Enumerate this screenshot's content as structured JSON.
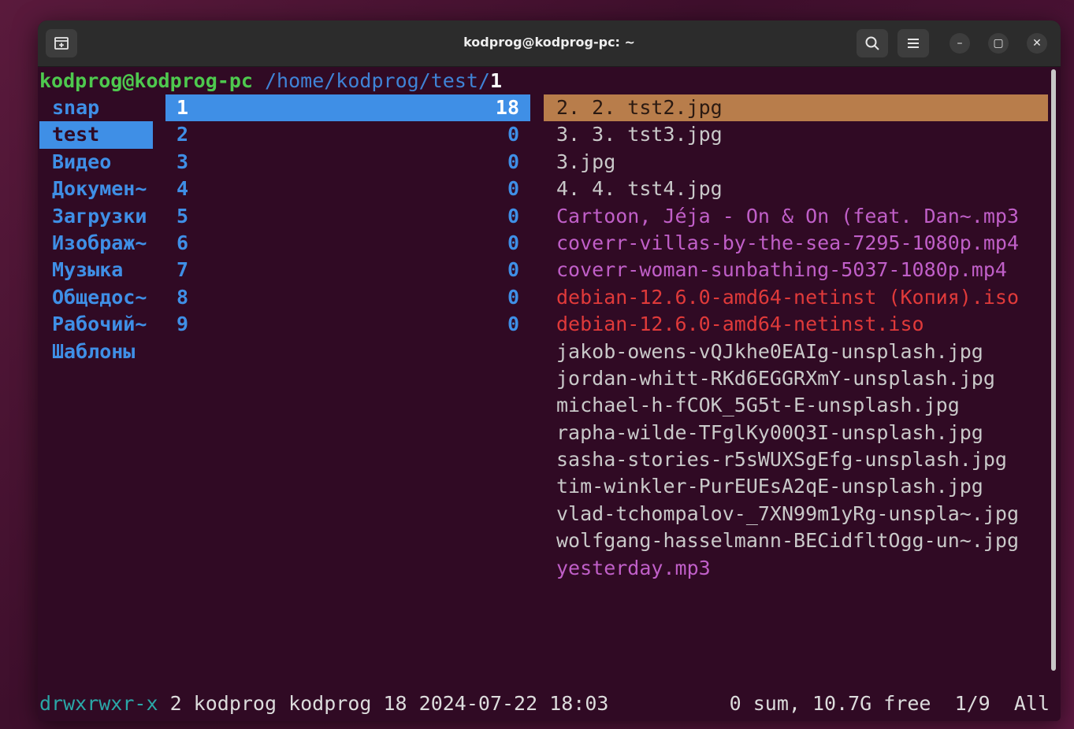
{
  "window": {
    "title": "kodprog@kodprog-pc: ~",
    "buttons": {
      "new_tab_icon": "new-tab-icon",
      "search_icon": "search-icon",
      "menu_icon": "hamburger-menu-icon",
      "minimize": "–",
      "maximize": "▢",
      "close": "✕"
    }
  },
  "prompt": {
    "user": "kodprog@kodprog-pc",
    "path": "/home/kodprog/test/",
    "current": "1"
  },
  "parent_dirs": [
    {
      "label": "snap"
    },
    {
      "label": "test"
    },
    {
      "label": "Видео"
    },
    {
      "label": "Докумен~"
    },
    {
      "label": "Загрузки"
    },
    {
      "label": "Изображ~"
    },
    {
      "label": "Музыка"
    },
    {
      "label": "Общедос~"
    },
    {
      "label": "Рабочий~"
    },
    {
      "label": "Шаблоны"
    }
  ],
  "current_dirs": [
    {
      "name": "1",
      "count": "18"
    },
    {
      "name": "2",
      "count": "0"
    },
    {
      "name": "3",
      "count": "0"
    },
    {
      "name": "4",
      "count": "0"
    },
    {
      "name": "5",
      "count": "0"
    },
    {
      "name": "6",
      "count": "0"
    },
    {
      "name": "7",
      "count": "0"
    },
    {
      "name": "8",
      "count": "0"
    },
    {
      "name": "9",
      "count": "0"
    }
  ],
  "preview_files": [
    {
      "name": "2. 2. tst2.jpg"
    },
    {
      "name": "3. 3. tst3.jpg"
    },
    {
      "name": "3.jpg"
    },
    {
      "name": "4. 4. tst4.jpg"
    },
    {
      "name": "Cartoon, Jéja - On & On (feat. Dan~.mp3"
    },
    {
      "name": "coverr-villas-by-the-sea-7295-1080p.mp4"
    },
    {
      "name": "coverr-woman-sunbathing-5037-1080p.mp4"
    },
    {
      "name": "debian-12.6.0-amd64-netinst (Копия).iso"
    },
    {
      "name": "debian-12.6.0-amd64-netinst.iso"
    },
    {
      "name": "jakob-owens-vQJkhe0EAIg-unsplash.jpg"
    },
    {
      "name": "jordan-whitt-RKd6EGGRXmY-unsplash.jpg"
    },
    {
      "name": "michael-h-fCOK_5G5t-E-unsplash.jpg"
    },
    {
      "name": "rapha-wilde-TFglKy00Q3I-unsplash.jpg"
    },
    {
      "name": "sasha-stories-r5sWUXSgEfg-unsplash.jpg"
    },
    {
      "name": "tim-winkler-PurEUEsA2qE-unsplash.jpg"
    },
    {
      "name": "vlad-tchompalov-_7XN99m1yRg-unspla~.jpg"
    },
    {
      "name": "wolfgang-hasselmann-BECidfltOgg-un~.jpg"
    },
    {
      "name": "yesterday.mp3"
    }
  ],
  "status": {
    "perms": "drwxrwxr-x",
    "info": " 2 kodprog kodprog 18 2024-07-22 18:03",
    "right": "0 sum, 10.7G free  1/9  All"
  },
  "colors": {
    "terminal_bg": "#300a24",
    "dir_blue": "#3f8fe6",
    "prompt_green": "#4ec94e",
    "preview_highlight": "#b87d4b",
    "media": "#c05fc8",
    "archive": "#e03a3a",
    "perm_cyan": "#2aa7a7"
  }
}
